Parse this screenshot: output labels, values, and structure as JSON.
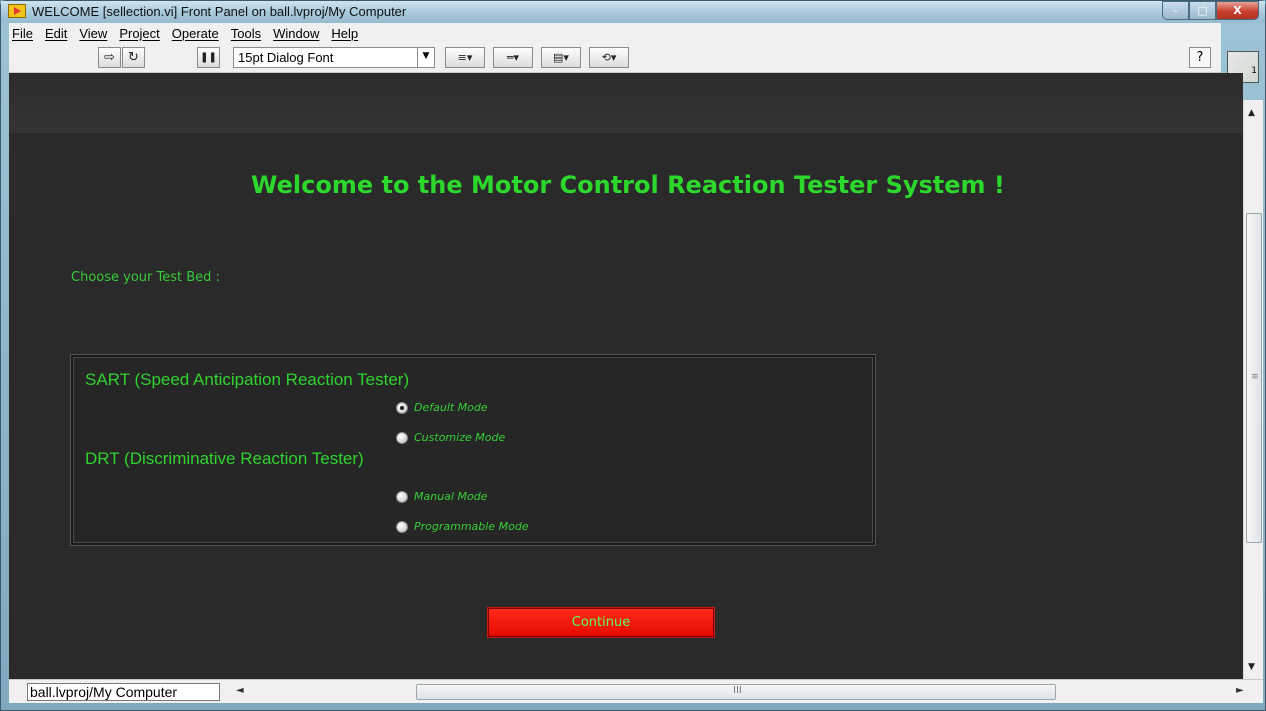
{
  "window": {
    "title": "WELCOME [sellection.vi] Front Panel on ball.lvproj/My Computer",
    "controls": {
      "minimize": "–",
      "maximize": "□",
      "close": "X"
    }
  },
  "menubar": {
    "items": [
      {
        "label": "File"
      },
      {
        "label": "Edit"
      },
      {
        "label": "View"
      },
      {
        "label": "Project"
      },
      {
        "label": "Operate"
      },
      {
        "label": "Tools"
      },
      {
        "label": "Window"
      },
      {
        "label": "Help"
      }
    ]
  },
  "toolbar": {
    "run_icon": "⇨",
    "run_continuous_icon": "↻",
    "pause_icon": "❚❚",
    "font": "15pt Dialog Font",
    "font_dropdown_icon": "▼",
    "align_icon": "≡▾",
    "distribute_icon": "═▾",
    "resize_icon": "▤▾",
    "reorder_icon": "⟲▾",
    "help_icon": "?",
    "vi_icon_label": "1"
  },
  "panel": {
    "headline": "Welcome to the Motor Control Reaction Tester System !",
    "choose_label": "Choose your Test Bed :",
    "groups": [
      {
        "title": "SART (Speed Anticipation Reaction Tester)",
        "options": [
          {
            "label": "Default Mode",
            "checked": true
          },
          {
            "label": "Customize Mode",
            "checked": false
          }
        ]
      },
      {
        "title": "DRT (Discriminative Reaction Tester)",
        "options": [
          {
            "label": "Manual Mode",
            "checked": false
          },
          {
            "label": "Programmable Mode",
            "checked": false
          }
        ]
      }
    ],
    "continue_label": "Continue"
  },
  "scrollbars": {
    "up_arrow": "▲",
    "down_arrow": "▼",
    "left_arrow": "◄",
    "right_arrow": "►",
    "grip": "≡",
    "h_grip": "III"
  },
  "statusbar": {
    "context": "ball.lvproj/My Computer"
  },
  "colors": {
    "panel_bg": "#2a2a2a",
    "accent_green": "#2dd82d",
    "continue_red": "#ee1b0f"
  }
}
